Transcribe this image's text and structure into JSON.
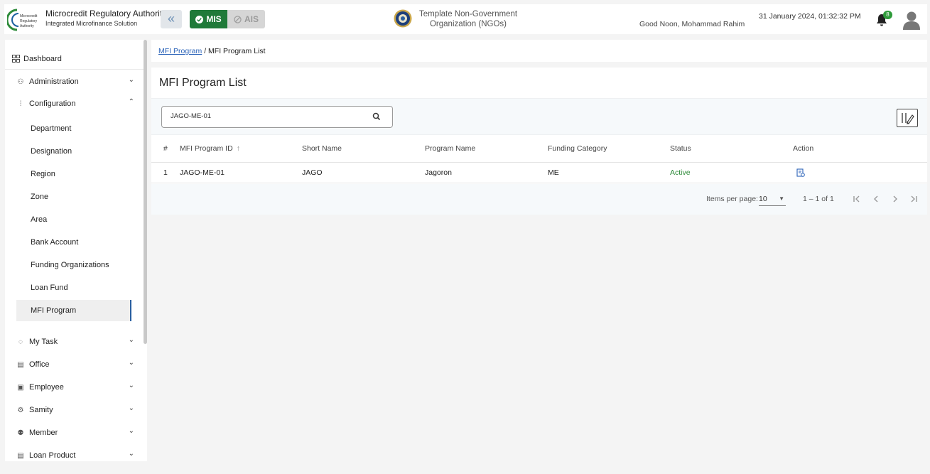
{
  "header": {
    "logo_text": [
      "Microcredit",
      "Regulatory",
      "Authority"
    ],
    "brand_title": "Microcredit Regulatory Authority",
    "brand_subtitle": "Integrated Microfinance Solution",
    "collapse_label": "«",
    "mis_label": "MIS",
    "ais_label": "AIS",
    "org_name_line1": "Template Non-Government",
    "org_name_line2": "Organization (NGOs)",
    "greeting": "Good Noon, Mohammad Rahim",
    "datetime": "31 January 2024, 01:32:32 PM",
    "notification_count": "8"
  },
  "sidebar": {
    "dashboard": "Dashboard",
    "administration": "Administration",
    "configuration": "Configuration",
    "config_items": [
      "Department",
      "Designation",
      "Region",
      "Zone",
      "Area",
      "Bank Account",
      "Funding Organizations",
      "Loan Fund",
      "MFI Program"
    ],
    "active_item": "MFI Program",
    "bottom_items": [
      "My Task",
      "Office",
      "Employee",
      "Samity",
      "Member",
      "Loan Product"
    ]
  },
  "breadcrumb": {
    "link": "MFI Program",
    "separator": "/",
    "current": "MFI Program List"
  },
  "main": {
    "title": "MFI Program List",
    "search_value": "JAGO-ME-01",
    "columns": [
      "#",
      "MFI Program ID",
      "Short Name",
      "Program Name",
      "Funding Category",
      "Status",
      "Action"
    ],
    "sort_indicator": "↑",
    "rows": [
      {
        "num": "1",
        "id": "JAGO-ME-01",
        "short": "JAGO",
        "name": "Jagoron",
        "category": "ME",
        "status": "Active"
      }
    ],
    "paginator": {
      "items_per_page_label": "Items per page:",
      "page_size": "10",
      "range": "1 – 1 of 1"
    }
  },
  "colors": {
    "mis_green": "#1f7a39",
    "active_status": "#2e8b3a",
    "link_blue": "#2a62b8",
    "active_indicator": "#2a5fa0"
  }
}
